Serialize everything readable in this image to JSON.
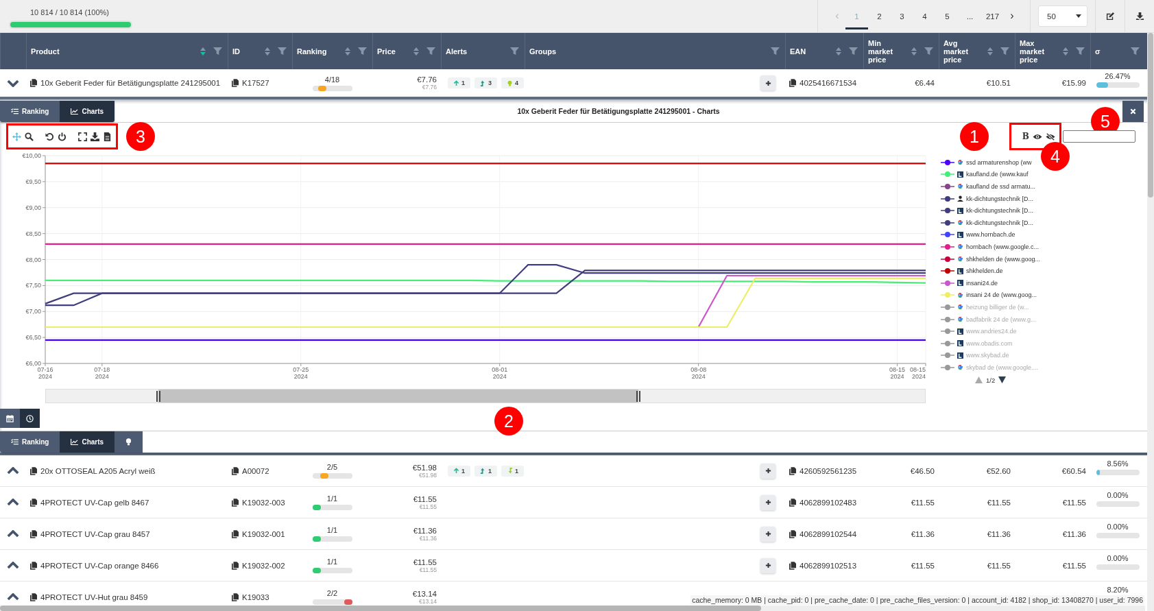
{
  "top_bar": {
    "progress_text": "10 814 / 10 814 (100%)",
    "progress": {
      "level": 1
    },
    "pagination": {
      "prev": {
        "label": "‹",
        "disabled": true
      },
      "pages": [
        {
          "label": "1",
          "selected": true
        },
        {
          "label": "2",
          "selected": false
        },
        {
          "label": "3",
          "selected": false
        },
        {
          "label": "4",
          "selected": false
        },
        {
          "label": "5",
          "selected": false
        },
        {
          "label": "...",
          "selected": false
        },
        {
          "label": "217",
          "selected": false
        }
      ],
      "next": {
        "label": "›",
        "disabled": false
      }
    },
    "per_page": "50"
  },
  "table": {
    "columns": [
      {
        "label": "Product",
        "sortable": true,
        "sorted_desc": true,
        "filter": true
      },
      {
        "label": "ID",
        "sortable": true,
        "sorted_desc": false,
        "filter": true
      },
      {
        "label": "Ranking",
        "sortable": true,
        "sorted_desc": false,
        "filter": true
      },
      {
        "label": "Price",
        "sortable": true,
        "sorted_desc": false,
        "filter": true
      },
      {
        "label": "Alerts",
        "sortable": false,
        "filter": true
      },
      {
        "label": "Groups",
        "sortable": false,
        "filter": true
      },
      {
        "label": "EAN",
        "sortable": true,
        "sorted_desc": false,
        "filter": true
      },
      {
        "label": "Min market price",
        "sortable": true,
        "sorted_desc": false,
        "filter": true
      },
      {
        "label": "Avg market price",
        "sortable": true,
        "sorted_desc": false,
        "filter": true
      },
      {
        "label": "Max market price",
        "sortable": true,
        "sorted_desc": false,
        "filter": true
      },
      {
        "label": "σ",
        "sortable": false,
        "filter": true
      }
    ],
    "rows": [
      {
        "expanded": true,
        "product": "10x Geberit Feder für Betätigungsplatte 241295001",
        "id": "K17527",
        "rank": "4/18",
        "rank_bar": {
          "level": 0.18,
          "color": "#f5a623"
        },
        "price": "€7.76",
        "price_sub": "€7.76",
        "alerts": [
          {
            "kind": "up",
            "count": "1"
          },
          {
            "kind": "trend-up",
            "count": "3"
          },
          {
            "kind": "bulb",
            "count": "4"
          }
        ],
        "ean": "4025416671534",
        "min": "€6.44",
        "avg": "€10.51",
        "max": "€15.99",
        "sigma": "26.47%",
        "sigma_bar": {
          "level": 0.27
        }
      },
      {
        "expanded": false,
        "product": "20x OTTOSEAL A205 Acryl weiß",
        "id": "A00072",
        "rank": "2/5",
        "rank_bar": {
          "level": 0.25,
          "color": "#f5a623"
        },
        "price": "€51.98",
        "price_sub": "€51.98",
        "alerts": [
          {
            "kind": "up",
            "count": "1"
          },
          {
            "kind": "trend-up",
            "count": "1"
          },
          {
            "kind": "trend-down",
            "count": "1"
          }
        ],
        "ean": "4260592561235",
        "min": "€46.50",
        "avg": "€52.60",
        "max": "€60.54",
        "sigma": "8.56%",
        "sigma_bar": {
          "level": 0.08
        }
      },
      {
        "expanded": false,
        "product": "4PROTECT UV-Cap gelb 8467",
        "id": "K19032-003",
        "rank": "1/1",
        "rank_bar": {
          "level": 0,
          "color": "#2ecc71"
        },
        "price": "€11.55",
        "price_sub": "€11.55",
        "alerts": [],
        "ean": "4062899102483",
        "min": "€11.55",
        "avg": "€11.55",
        "max": "€11.55",
        "sigma": "0.00%"
      },
      {
        "expanded": false,
        "product": "4PROTECT UV-Cap grau 8457",
        "id": "K19032-001",
        "rank": "1/1",
        "rank_bar": {
          "level": 0,
          "color": "#2ecc71"
        },
        "price": "€11.36",
        "price_sub": "€11.36",
        "alerts": [],
        "ean": "4062899102544",
        "min": "€11.36",
        "avg": "€11.36",
        "max": "€11.36",
        "sigma": "0.00%"
      },
      {
        "expanded": false,
        "product": "4PROTECT UV-Cap orange 8466",
        "id": "K19032-002",
        "rank": "1/1",
        "rank_bar": {
          "level": 0,
          "color": "#2ecc71"
        },
        "price": "€11.55",
        "price_sub": "€11.55",
        "alerts": [],
        "ean": "4062899102513",
        "min": "€11.55",
        "avg": "€11.55",
        "max": "€11.55",
        "sigma": "0.00%"
      },
      {
        "expanded": false,
        "product": "4PROTECT UV-Hut grau 8459",
        "id": "K19033",
        "rank": "2/2",
        "rank_bar": {
          "level": 1,
          "color": "#e05a5a"
        },
        "price": "€13.14",
        "price_sub": "€13.14",
        "alerts": [],
        "sigma": "8.20%"
      }
    ]
  },
  "detail": {
    "tabs": [
      {
        "label": "Ranking",
        "kind": "list",
        "selected": false
      },
      {
        "label": "Charts",
        "kind": "chart",
        "selected": true
      }
    ],
    "title": "10x Geberit Feder für Betätigungsplatte 241295001 - Charts",
    "chart_tools": [
      {
        "kind": "pan",
        "selected": true
      },
      {
        "kind": "zoom",
        "selected": false
      },
      {
        "kind": "undo",
        "selected": false
      },
      {
        "kind": "power",
        "selected": false
      },
      {
        "kind": "fullscreen",
        "selected": false
      },
      {
        "kind": "download",
        "selected": false
      },
      {
        "kind": "document",
        "selected": false
      }
    ],
    "legend_tools": {
      "bold_label": "B"
    },
    "chart_data": {
      "type": "line",
      "grid": true,
      "categories": [
        "07-16 2024",
        null,
        "07-18 2024",
        null,
        null,
        null,
        null,
        null,
        null,
        "07-25 2024",
        null,
        null,
        null,
        null,
        null,
        null,
        "08-01 2024",
        null,
        null,
        null,
        null,
        null,
        null,
        "08-08 2024",
        null,
        null,
        null,
        null,
        null,
        null,
        "08-15 2024",
        "08-15 2024"
      ],
      "ylim": [
        6,
        10
      ],
      "yticks": [
        {
          "value": 6,
          "label": "€6,00"
        },
        {
          "value": 6.5,
          "label": "€6,50"
        },
        {
          "value": 7,
          "label": "€7,00"
        },
        {
          "value": 7.5,
          "label": "€7,50"
        },
        {
          "value": 8,
          "label": "€8,00"
        },
        {
          "value": 8.5,
          "label": "€8,50"
        },
        {
          "value": 9,
          "label": "€9,00"
        },
        {
          "value": 9.5,
          "label": "€9,50"
        },
        {
          "value": 10,
          "label": "€10,00"
        }
      ],
      "series": [
        {
          "name": "ssd armaturenshop (ww",
          "color": "#4b00ff",
          "values": [
            6.45,
            6.45,
            6.45,
            6.45,
            6.45,
            6.45,
            6.45,
            6.45,
            6.45,
            6.45,
            6.45,
            6.45,
            6.45,
            6.45,
            6.45,
            6.45,
            6.45,
            6.45,
            6.45,
            6.45,
            6.45,
            6.45,
            6.45,
            6.45,
            6.45,
            6.45,
            6.45,
            6.45,
            6.45,
            6.45,
            6.45,
            6.45
          ]
        },
        {
          "name": "kaufland.de (www.kauf",
          "color": "#44ee77",
          "values": [
            7.6,
            7.6,
            7.6,
            7.6,
            7.6,
            7.6,
            7.6,
            7.6,
            7.6,
            7.6,
            7.6,
            7.6,
            7.6,
            7.6,
            7.6,
            7.6,
            7.59,
            7.59,
            7.59,
            7.59,
            7.59,
            7.59,
            7.58,
            7.58,
            7.58,
            7.58,
            7.58,
            7.57,
            7.57,
            7.57,
            7.56,
            7.55
          ]
        },
        {
          "name": "kaufland de ssd armatu...",
          "color": "#884488",
          "values": [
            null,
            null,
            null,
            null,
            null,
            null,
            null,
            null,
            null,
            null,
            null,
            null,
            null,
            null,
            null,
            null,
            null,
            null,
            null,
            null,
            null,
            null,
            null,
            null,
            null,
            null,
            null,
            null,
            null,
            null,
            null,
            null
          ]
        },
        {
          "name": "kk-dichtungstechnik [D...",
          "color": "#3f3d7c",
          "values": [
            7.15,
            7.35,
            7.35,
            7.35,
            7.35,
            7.35,
            7.35,
            7.35,
            7.35,
            7.35,
            7.35,
            7.35,
            7.35,
            7.35,
            7.35,
            7.35,
            7.35,
            7.9,
            7.9,
            7.74,
            7.74,
            7.74,
            7.74,
            7.74,
            7.74,
            7.74,
            7.74,
            7.74,
            7.74,
            7.74,
            7.74,
            7.74
          ]
        },
        {
          "name": "kk-dichtungstechnik [D...",
          "color": "#3f3d7c",
          "values": [
            7.12,
            7.12,
            7.35,
            7.35,
            7.35,
            7.35,
            7.35,
            7.35,
            7.35,
            7.35,
            7.35,
            7.35,
            7.35,
            7.35,
            7.35,
            7.35,
            7.35,
            7.35,
            7.35,
            7.79,
            7.79,
            7.79,
            7.79,
            7.79,
            7.79,
            7.79,
            7.79,
            7.79,
            7.79,
            7.79,
            7.79,
            7.79
          ]
        },
        {
          "name": "kk-dichtungstechnik [D...",
          "color": "#3f3d7c",
          "values": [
            null,
            null,
            null,
            null,
            null,
            null,
            null,
            null,
            null,
            null,
            null,
            null,
            null,
            null,
            null,
            null,
            null,
            null,
            null,
            null,
            null,
            null,
            null,
            null,
            null,
            null,
            null,
            null,
            null,
            null,
            null,
            null
          ]
        },
        {
          "name": "www.hornbach.de",
          "color": "#4444ff",
          "values": [
            null,
            null,
            null,
            null,
            null,
            null,
            null,
            null,
            null,
            null,
            null,
            null,
            null,
            null,
            null,
            null,
            null,
            null,
            null,
            null,
            null,
            null,
            null,
            null,
            null,
            null,
            null,
            null,
            null,
            null,
            null,
            null
          ]
        },
        {
          "name": "hornbach (www.google.c...",
          "color": "#e0208c",
          "values": [
            8.3,
            8.3,
            8.3,
            8.3,
            8.3,
            8.3,
            8.3,
            8.3,
            8.3,
            8.3,
            8.3,
            8.3,
            8.3,
            8.3,
            8.3,
            8.3,
            8.3,
            8.3,
            8.3,
            8.3,
            8.3,
            8.3,
            8.3,
            8.3,
            8.3,
            8.3,
            8.3,
            8.3,
            8.3,
            8.3,
            8.3,
            8.3
          ]
        },
        {
          "name": "shkhelden de (www.goog...",
          "color": "#c8003c",
          "values": [
            null,
            null,
            null,
            null,
            null,
            null,
            null,
            null,
            null,
            null,
            null,
            null,
            null,
            null,
            null,
            null,
            null,
            null,
            null,
            null,
            null,
            null,
            null,
            null,
            null,
            null,
            null,
            null,
            null,
            null,
            null,
            null
          ]
        },
        {
          "name": "shkhelden.de",
          "color": "#c00000",
          "values": [
            9.85,
            9.85,
            9.85,
            9.85,
            9.85,
            9.85,
            9.85,
            9.85,
            9.85,
            9.85,
            9.85,
            9.85,
            9.85,
            9.85,
            9.85,
            9.85,
            9.85,
            9.85,
            9.85,
            9.85,
            9.85,
            9.85,
            9.85,
            9.85,
            9.85,
            9.85,
            9.85,
            9.85,
            9.85,
            9.85,
            9.85,
            9.85
          ]
        },
        {
          "name": "insani24.de",
          "color": "#cc55cc",
          "values": [
            null,
            null,
            null,
            null,
            null,
            null,
            null,
            null,
            null,
            null,
            null,
            null,
            null,
            null,
            null,
            null,
            null,
            null,
            null,
            null,
            null,
            null,
            null,
            6.7,
            7.69,
            7.69,
            7.69,
            7.69,
            7.69,
            7.69,
            7.69,
            7.69
          ]
        },
        {
          "name": "insani 24 de (www.goog...",
          "color": "#eeee66",
          "values": [
            6.7,
            6.7,
            6.7,
            6.7,
            6.7,
            6.7,
            6.7,
            6.7,
            6.7,
            6.7,
            6.7,
            6.7,
            6.7,
            6.7,
            6.7,
            6.7,
            6.7,
            6.7,
            6.7,
            6.7,
            6.7,
            6.7,
            6.7,
            6.7,
            6.7,
            7.64,
            7.64,
            7.64,
            7.64,
            7.64,
            7.64,
            7.64
          ]
        },
        {
          "name": "heizung billiger de (w...",
          "color": "#999999",
          "values": [
            null,
            null,
            null,
            null,
            null,
            null,
            null,
            null,
            null,
            null,
            null,
            null,
            null,
            null,
            null,
            null,
            null,
            null,
            null,
            null,
            null,
            null,
            null,
            null,
            null,
            null,
            null,
            null,
            null,
            null,
            null,
            null
          ]
        },
        {
          "name": "badfabrik 24 de (www.g...",
          "color": "#999999",
          "values": [
            null,
            null,
            null,
            null,
            null,
            null,
            null,
            null,
            null,
            null,
            null,
            null,
            null,
            null,
            null,
            null,
            null,
            null,
            null,
            null,
            null,
            null,
            null,
            null,
            null,
            null,
            null,
            null,
            null,
            null,
            null,
            null
          ]
        },
        {
          "name": "www.andries24.de",
          "color": "#999999",
          "values": [
            null,
            null,
            null,
            null,
            null,
            null,
            null,
            null,
            null,
            null,
            null,
            null,
            null,
            null,
            null,
            null,
            null,
            null,
            null,
            null,
            null,
            null,
            null,
            null,
            null,
            null,
            null,
            null,
            null,
            null,
            null,
            null
          ]
        },
        {
          "name": "www.obadis.com",
          "color": "#999999",
          "values": [
            null,
            null,
            null,
            null,
            null,
            null,
            null,
            null,
            null,
            null,
            null,
            null,
            null,
            null,
            null,
            null,
            null,
            null,
            null,
            null,
            null,
            null,
            null,
            null,
            null,
            null,
            null,
            null,
            null,
            null,
            null,
            null
          ]
        },
        {
          "name": "www.skybad.de",
          "color": "#999999",
          "values": [
            null,
            null,
            null,
            null,
            null,
            null,
            null,
            null,
            null,
            null,
            null,
            null,
            null,
            null,
            null,
            null,
            null,
            null,
            null,
            null,
            null,
            null,
            null,
            null,
            null,
            null,
            null,
            null,
            null,
            null,
            null,
            null
          ]
        },
        {
          "name": "skybad de (www.google....",
          "color": "#999999",
          "values": [
            null,
            null,
            null,
            null,
            null,
            null,
            null,
            null,
            null,
            null,
            null,
            null,
            null,
            null,
            null,
            null,
            null,
            null,
            null,
            null,
            null,
            null,
            null,
            null,
            null,
            null,
            null,
            null,
            null,
            null,
            null,
            null
          ]
        }
      ]
    },
    "legend_items": [
      {
        "kind": "google",
        "hidden": false
      },
      {
        "kind": "logo",
        "hidden": false
      },
      {
        "kind": "google",
        "hidden": false
      },
      {
        "kind": "person",
        "hidden": false
      },
      {
        "kind": "logo",
        "hidden": false
      },
      {
        "kind": "google",
        "hidden": false
      },
      {
        "kind": "logo",
        "hidden": false
      },
      {
        "kind": "google",
        "hidden": false
      },
      {
        "kind": "google",
        "hidden": false
      },
      {
        "kind": "logo",
        "hidden": false
      },
      {
        "kind": "logo",
        "hidden": false
      },
      {
        "kind": "google",
        "hidden": false
      },
      {
        "kind": "google",
        "hidden": true
      },
      {
        "kind": "google",
        "hidden": true
      },
      {
        "kind": "logo",
        "hidden": true
      },
      {
        "kind": "logo",
        "hidden": true
      },
      {
        "kind": "logo",
        "hidden": true
      },
      {
        "kind": "google",
        "hidden": true
      }
    ],
    "legend_page": "1/2",
    "range_buttons": [
      {
        "kind": "calendar",
        "selected": false
      },
      {
        "kind": "clock",
        "selected": true
      }
    ],
    "bottom_tabs": [
      {
        "label": "Ranking",
        "kind": "list",
        "selected": false
      },
      {
        "label": "Charts",
        "kind": "chart",
        "selected": true
      },
      {
        "kind": "bulb",
        "selected": false
      }
    ]
  },
  "callouts": [
    "1",
    "2",
    "3",
    "4",
    "5"
  ],
  "status_text": "cache_memory: 0 MB | cache_pid: 0 | pre_cache_date: 0 | pre_cache_files_version: 0 | account_id: 4182 | shop_id: 13408270 | user_id: 7996"
}
